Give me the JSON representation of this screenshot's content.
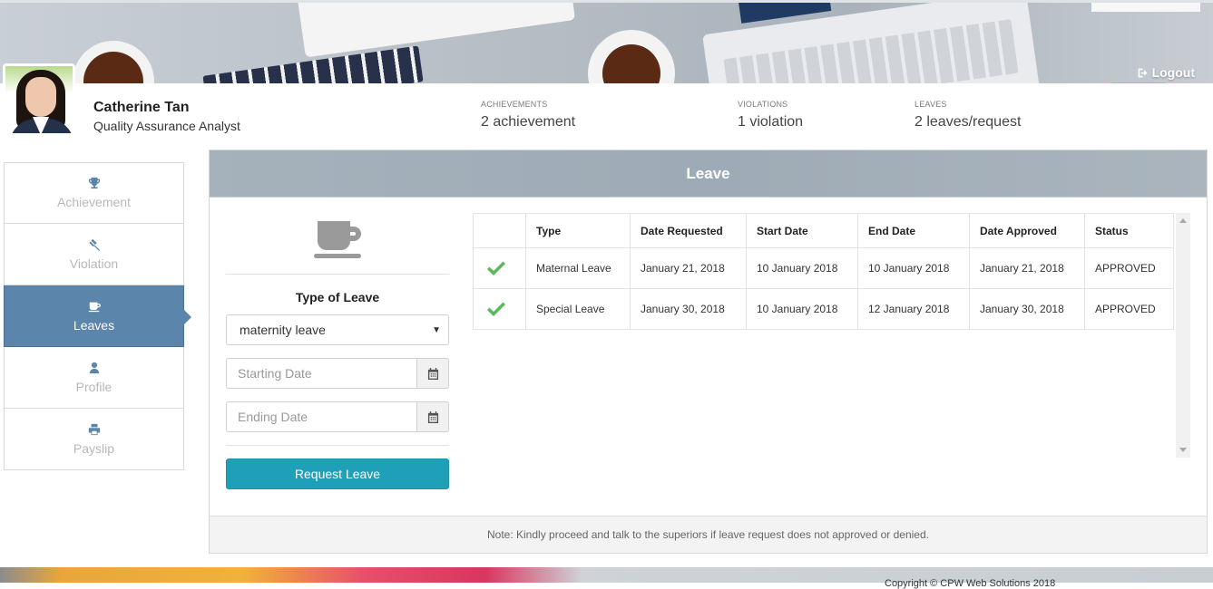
{
  "header": {
    "logout_label": "Logout",
    "user_name": "Catherine Tan",
    "user_role": "Quality Assurance Analyst",
    "stats": [
      {
        "label": "ACHIEVEMENTS",
        "value": "2 achievement"
      },
      {
        "label": "VIOLATIONS",
        "value": "1 violation"
      },
      {
        "label": "LEAVES",
        "value": "2 leaves/request"
      }
    ]
  },
  "sidebar": {
    "items": [
      {
        "label": "Achievement",
        "icon": "trophy-icon"
      },
      {
        "label": "Violation",
        "icon": "gavel-icon"
      },
      {
        "label": "Leaves",
        "icon": "coffee-icon",
        "active": true
      },
      {
        "label": "Profile",
        "icon": "user-icon"
      },
      {
        "label": "Payslip",
        "icon": "printer-icon"
      }
    ]
  },
  "panel": {
    "title": "Leave",
    "form": {
      "type_label": "Type of Leave",
      "selected_type": "maternity leave",
      "start_placeholder": "Starting Date",
      "end_placeholder": "Ending Date",
      "submit_label": "Request Leave"
    },
    "table": {
      "columns": [
        "",
        "Type",
        "Date Requested",
        "Start Date",
        "End Date",
        "Date Approved",
        "Status"
      ],
      "rows": [
        {
          "type": "Maternal Leave",
          "date_requested": "January 21, 2018",
          "start_date": "10 January 2018",
          "end_date": "10 January 2018",
          "date_approved": "January 21, 2018",
          "status": "APPROVED"
        },
        {
          "type": "Special Leave",
          "date_requested": "January 30, 2018",
          "start_date": "10 January 2018",
          "end_date": "12 January 2018",
          "date_approved": "January 30, 2018",
          "status": "APPROVED"
        }
      ]
    },
    "note": "Note: Kindly proceed and talk to the superiors if leave request does not approved or denied."
  },
  "footer": {
    "copyright": "Copyright © CPW Web Solutions 2018"
  },
  "colors": {
    "accent": "#5b85ab",
    "button": "#1fa0b8",
    "approved_check": "#5cb85c"
  }
}
